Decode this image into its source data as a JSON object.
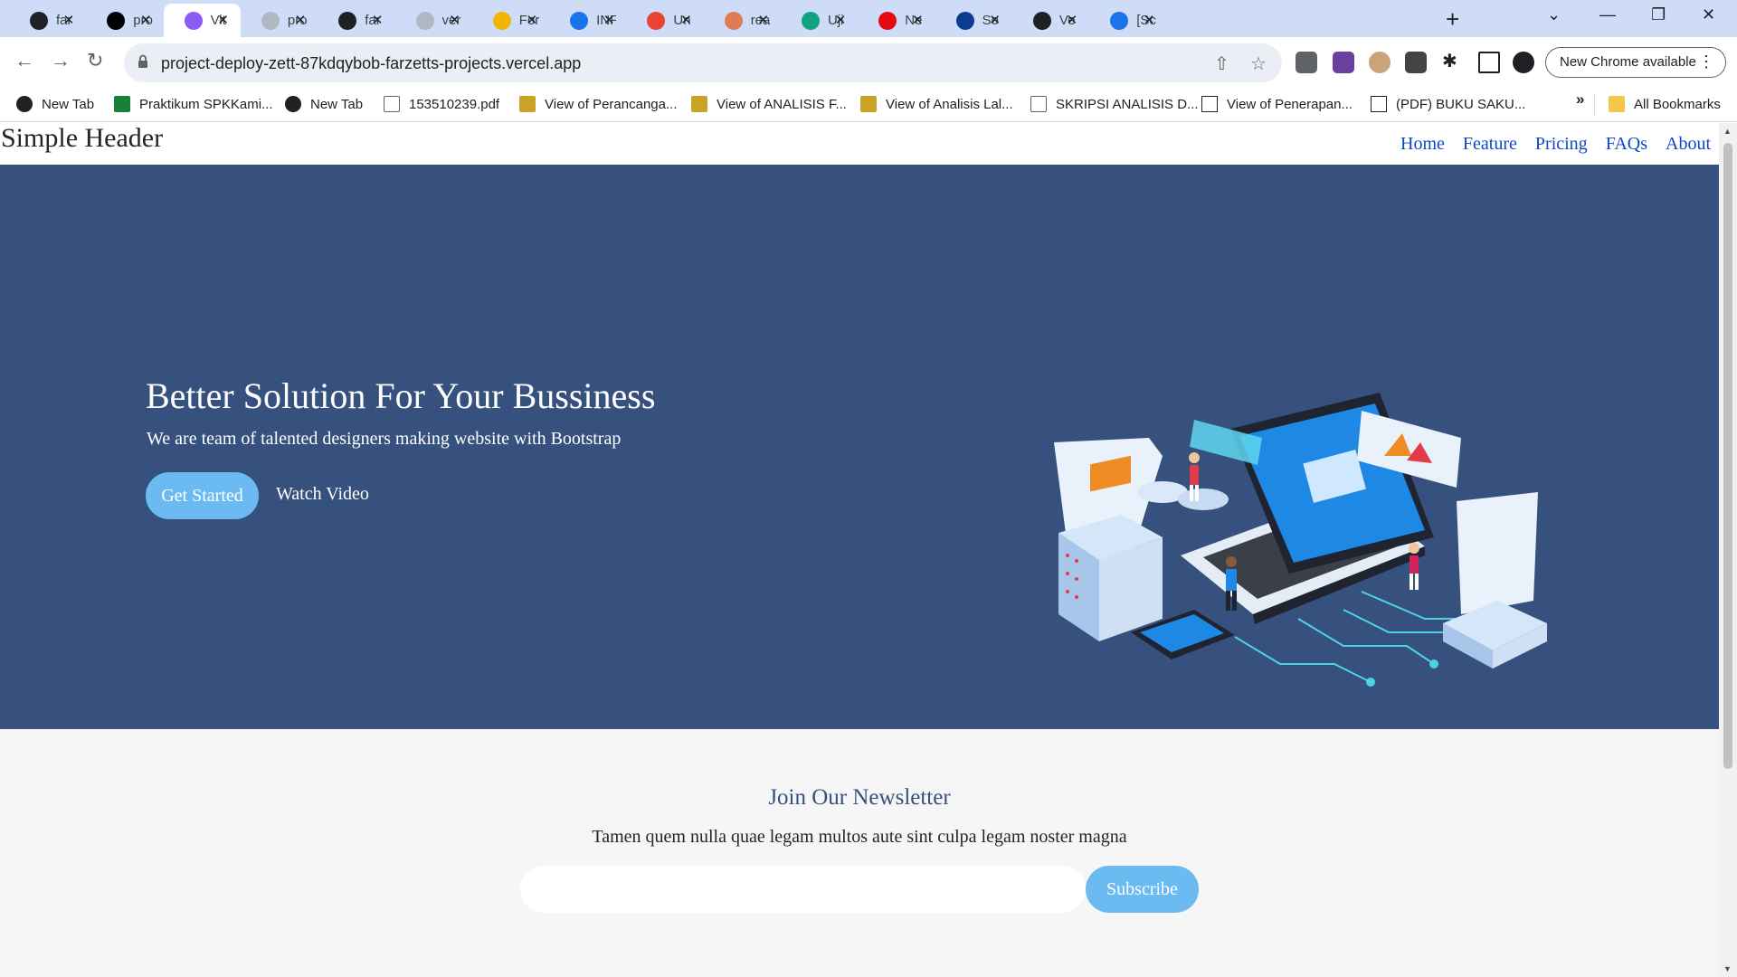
{
  "browser": {
    "tabs": [
      {
        "title": "far",
        "icon": "github-icon",
        "color": "#202124"
      },
      {
        "title": "pro",
        "icon": "vercel-icon",
        "color": "#000000"
      },
      {
        "title": "Vit",
        "icon": "vite-icon",
        "color": "#8a5cf6"
      },
      {
        "title": "pro",
        "icon": "globe-icon",
        "color": "#b0b8c6"
      },
      {
        "title": "far",
        "icon": "github-icon",
        "color": "#202124"
      },
      {
        "title": "ver",
        "icon": "globe-icon",
        "color": "#b0b8c6"
      },
      {
        "title": "For",
        "icon": "classroom-icon",
        "color": "#f2b600"
      },
      {
        "title": "INF",
        "icon": "contacts-icon",
        "color": "#1a73e8"
      },
      {
        "title": "Un",
        "icon": "gmail-icon",
        "color": "#ea4335"
      },
      {
        "title": "rea",
        "icon": "feather-icon",
        "color": "#e07b53"
      },
      {
        "title": "Uji",
        "icon": "openai-icon",
        "color": "#10a37f"
      },
      {
        "title": "Ne",
        "icon": "netflix-icon",
        "color": "#e50914"
      },
      {
        "title": "So",
        "icon": "onedrive-icon",
        "color": "#0a3d91"
      },
      {
        "title": "Ve",
        "icon": "bar-icon",
        "color": "#202124"
      },
      {
        "title": "[Sc",
        "icon": "canva-icon",
        "color": "#1a73e8"
      }
    ],
    "url": "project-deploy-zett-87kdqybob-farzetts-projects.vercel.app",
    "update_label": "New Chrome available",
    "bookmarks": [
      {
        "label": "New Tab",
        "icon": "globe-icon"
      },
      {
        "label": "Praktikum SPKKami...",
        "icon": "sheet-icon"
      },
      {
        "label": "New Tab",
        "icon": "globe-icon"
      },
      {
        "label": "153510239.pdf",
        "icon": "document-icon"
      },
      {
        "label": "View of Perancanga...",
        "icon": "journal-icon"
      },
      {
        "label": "View of ANALISIS F...",
        "icon": "journal-icon"
      },
      {
        "label": "View of Analisis Lal...",
        "icon": "journal-icon"
      },
      {
        "label": "SKRIPSI ANALISIS D...",
        "icon": "document-icon"
      },
      {
        "label": "View of Penerapan...",
        "icon": "pkp-icon"
      },
      {
        "label": "(PDF) BUKU SAKU...",
        "icon": "researchgate-icon"
      }
    ],
    "bookmarks_all": "All Bookmarks"
  },
  "site": {
    "brand": "Simple Header",
    "nav": [
      "Home",
      "Feature",
      "Pricing",
      "FAQs",
      "About"
    ],
    "hero": {
      "title": "Better Solution For Your Bussiness",
      "subtitle": "We are team of talented designers making website with Bootstrap",
      "primary_button": "Get Started",
      "secondary_link": "Watch Video",
      "background": "#36517e"
    },
    "newsletter": {
      "title": "Join Our Newsletter",
      "text": "Tamen quem nulla quae legam multos aute sint culpa legam noster magna",
      "input_value": "",
      "button": "Subscribe",
      "accent": "#6bbaf2"
    }
  }
}
